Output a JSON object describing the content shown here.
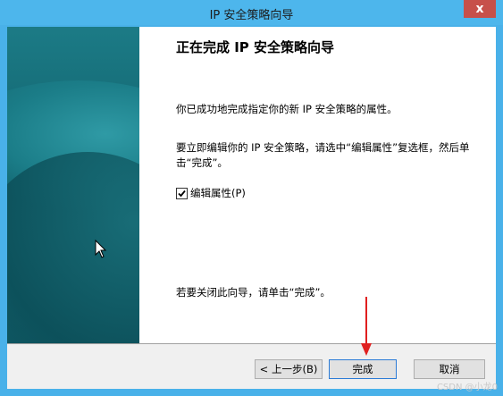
{
  "window": {
    "title": "IP 安全策略向导",
    "close_glyph": "x"
  },
  "wizard": {
    "heading": "正在完成 IP 安全策略向导",
    "para1": "你已成功地完成指定你的新 IP 安全策略的属性。",
    "para2": "要立即编辑你的 IP 安全策略，请选中“编辑属性”复选框，然后单击“完成”。",
    "checkbox": {
      "label": "编辑属性(P)",
      "checked": true
    },
    "para3": "若要关闭此向导，请单击“完成”。"
  },
  "buttons": {
    "back": "< 上一步(B)",
    "finish": "完成",
    "cancel": "取消"
  },
  "watermark": "CSDN @小龙0",
  "colors": {
    "titlebar": "#4db6ec",
    "close": "#c7504a",
    "banner": "#126570",
    "arrow": "#e02020"
  }
}
